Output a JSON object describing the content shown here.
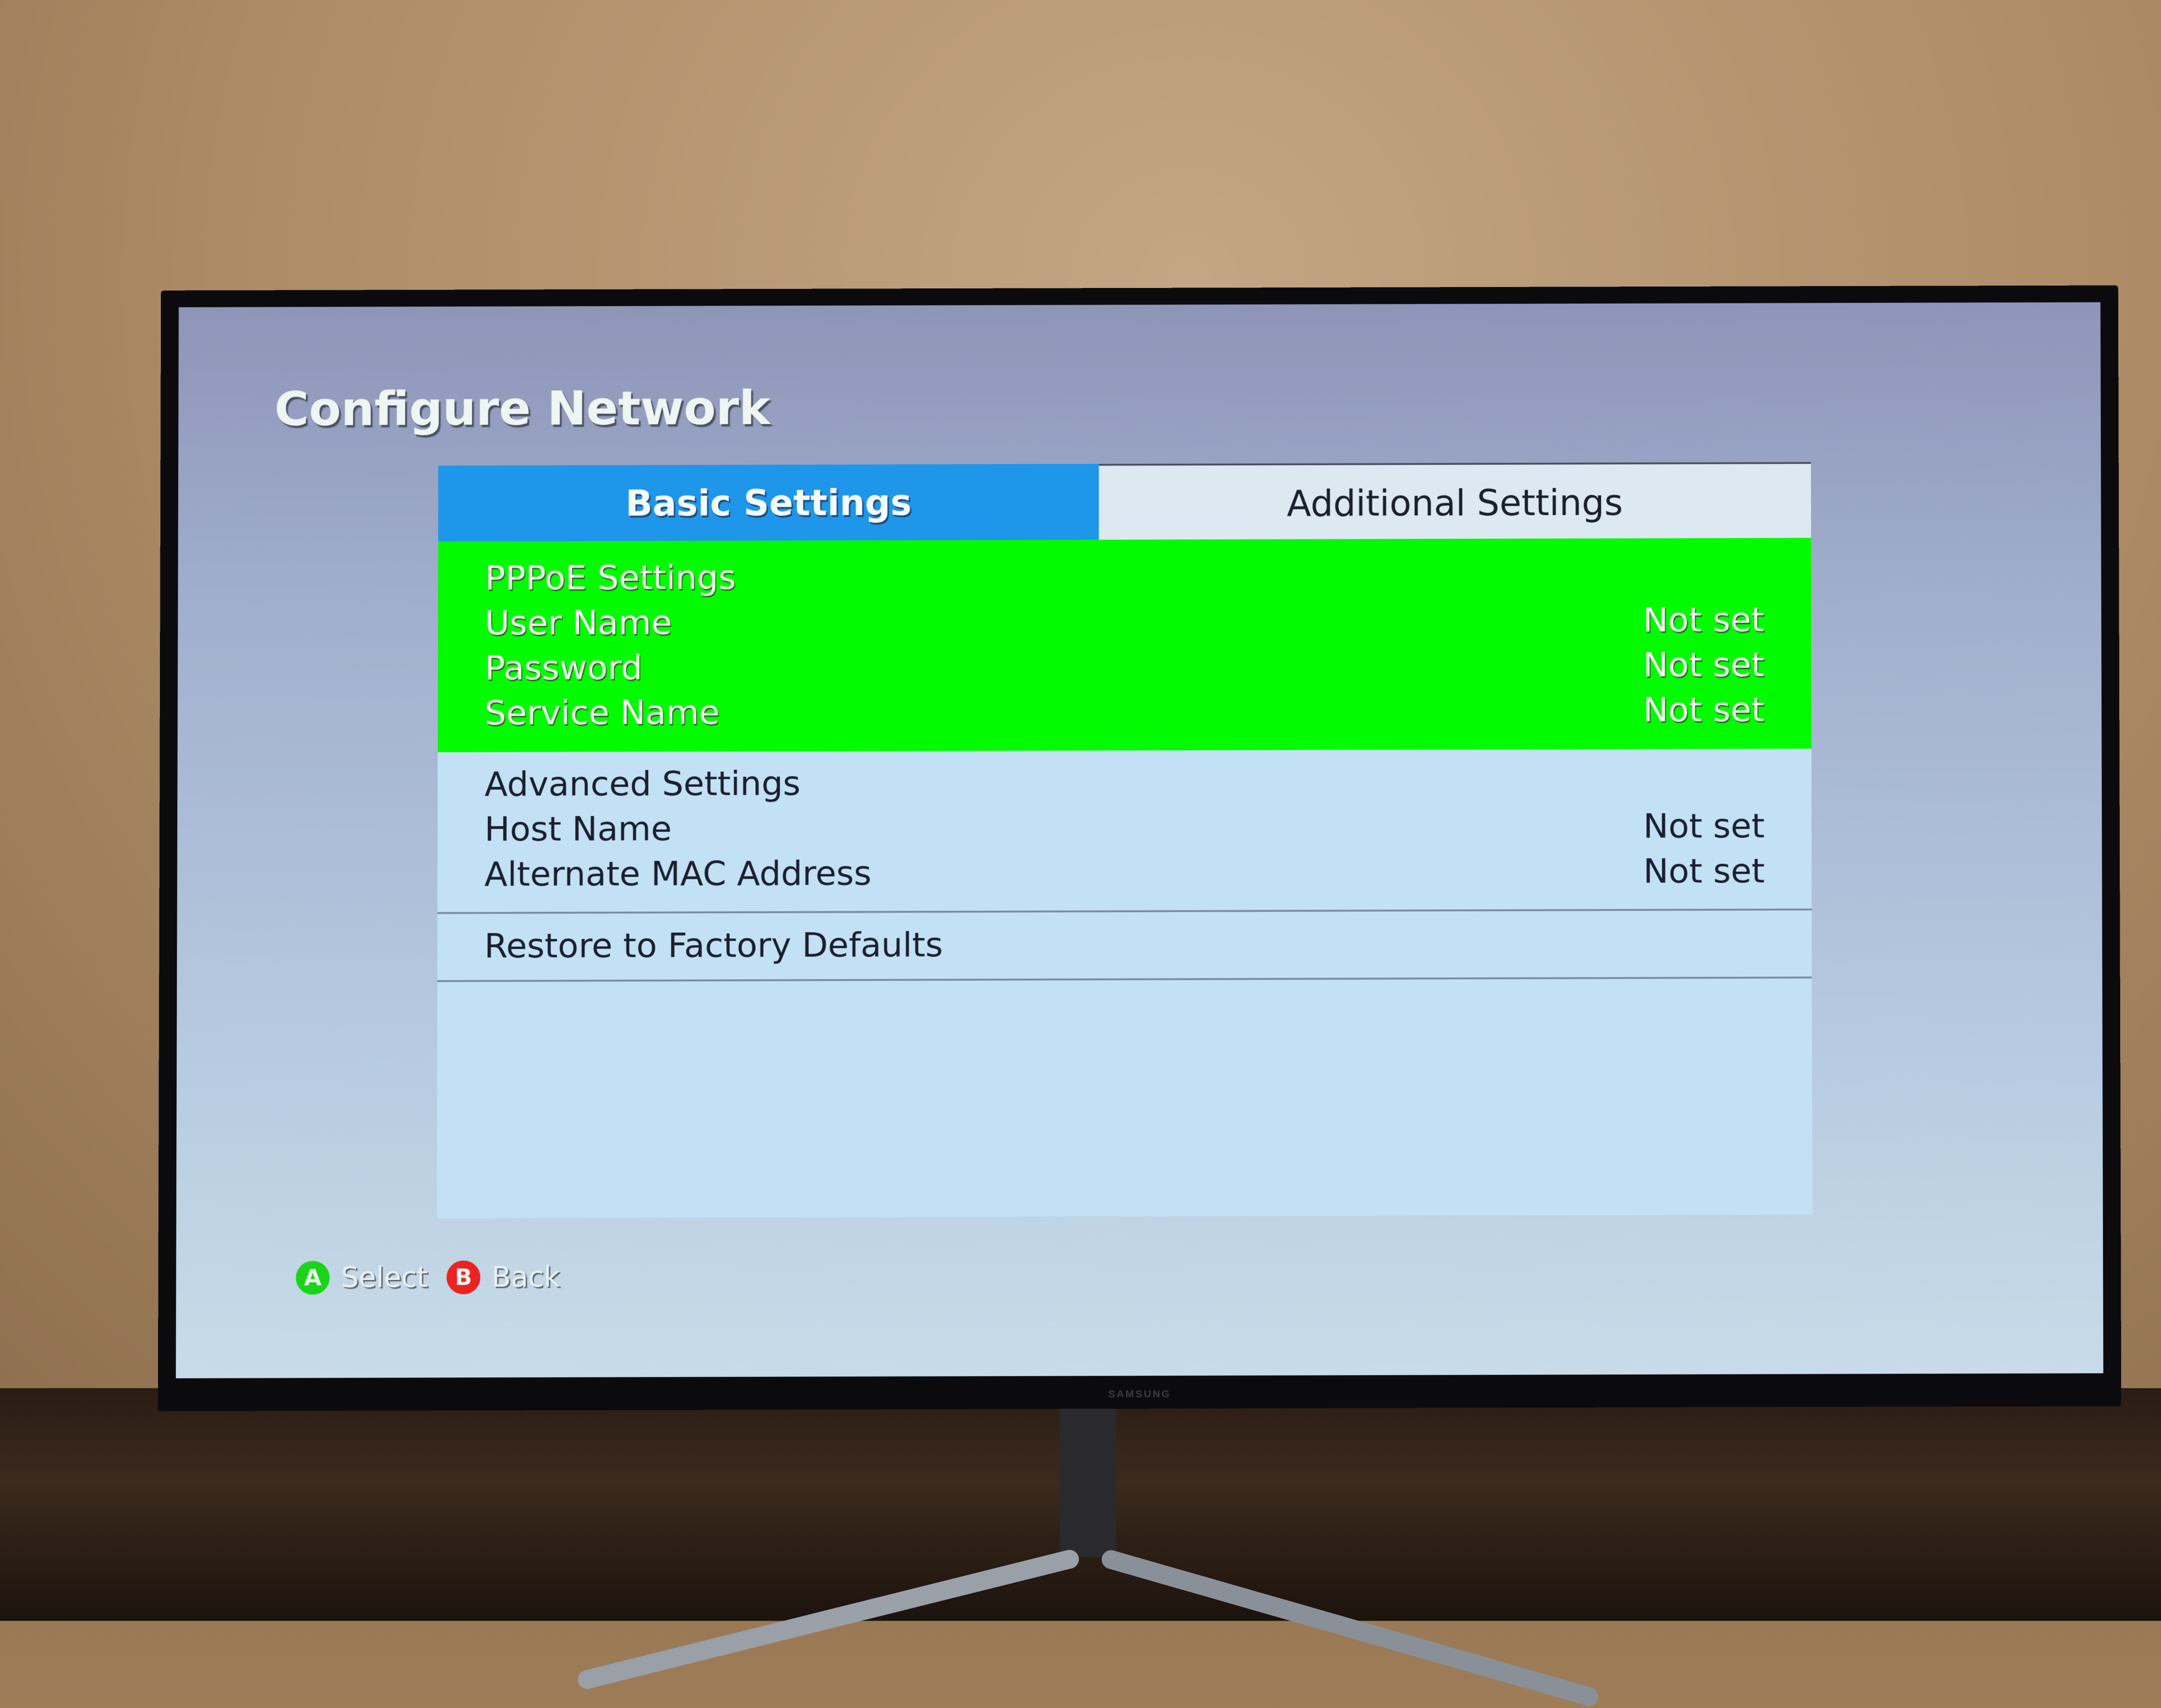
{
  "screen": {
    "title": "Configure Network",
    "tabs": [
      {
        "label": "Basic Settings",
        "active": true
      },
      {
        "label": "Additional Settings",
        "active": false
      }
    ],
    "groups": [
      {
        "heading": "PPPoE Settings",
        "selected": true,
        "rows": [
          {
            "label": "User Name",
            "value": "Not set"
          },
          {
            "label": "Password",
            "value": "Not set"
          },
          {
            "label": "Service Name",
            "value": "Not set"
          }
        ]
      },
      {
        "heading": "Advanced Settings",
        "selected": false,
        "rows": [
          {
            "label": "Host Name",
            "value": "Not set"
          },
          {
            "label": "Alternate MAC Address",
            "value": "Not set"
          }
        ]
      },
      {
        "heading": "Restore to Factory Defaults",
        "selected": false,
        "rows": []
      }
    ],
    "footer": {
      "select": {
        "button": "A",
        "label": "Select"
      },
      "back": {
        "button": "B",
        "label": "Back"
      }
    },
    "colors": {
      "active_tab": "#1e96ea",
      "selected_item": "#03fb00",
      "button_a": "#19d419",
      "button_b": "#ee2222"
    }
  },
  "tv": {
    "brand": "SAMSUNG"
  }
}
